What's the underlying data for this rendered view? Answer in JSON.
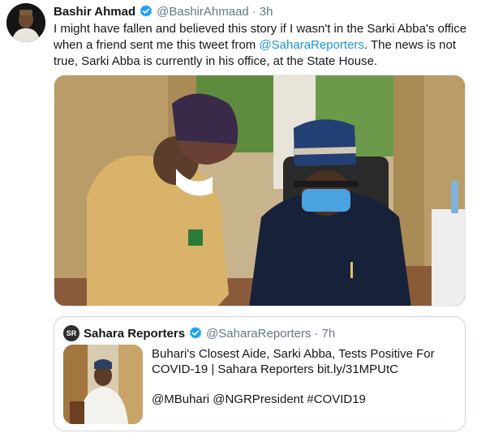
{
  "tweet": {
    "author_name": "Bashir Ahmad",
    "author_handle": "@BashirAhmaad",
    "separator": "·",
    "time": "3h",
    "text_part1": "I might have fallen and believed this story if I wasn't in the Sarki Abba's office when a friend sent me this tweet from ",
    "mention": "@SaharaReporters",
    "text_part2": ". The news is not true, Sarki Abba is currently in his office, at the State House."
  },
  "quoted_tweet": {
    "avatar_text": "SR",
    "author_name": "Sahara Reporters",
    "author_handle": "@SaharaReporters",
    "separator": "·",
    "time": "7h",
    "text": "Buhari's Closest Aide, Sarki Abba, Tests Positive For COVID-19 | Sahara Reporters bit.ly/31MPUtC",
    "tags": "@MBuhari @NGRPresident #COVID19"
  },
  "colors": {
    "link": "#1b95e0",
    "verified": "#1da1f2",
    "muted": "#657786"
  }
}
